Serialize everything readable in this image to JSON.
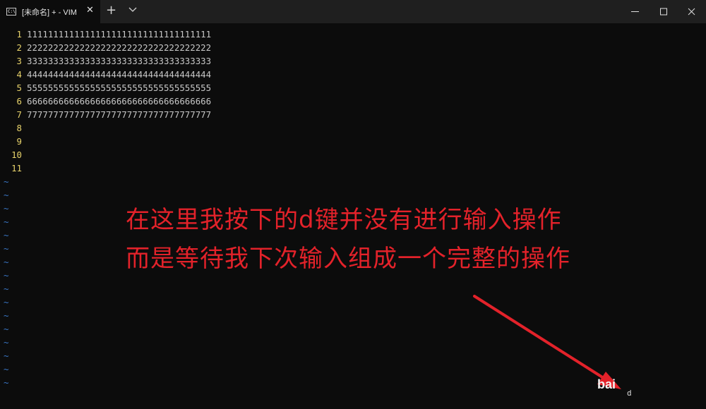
{
  "tab": {
    "icon": "console-icon",
    "title": "[未命名] + - VIM",
    "close": "✕"
  },
  "new_tab": "+",
  "window_controls": [
    "minimize-icon",
    "maximize-icon",
    "close-icon"
  ],
  "editor": {
    "lines": [
      {
        "num": "1",
        "text": "11111111111111111111111111111111111"
      },
      {
        "num": "2",
        "text": "22222222222222222222222222222222222"
      },
      {
        "num": "3",
        "text": "33333333333333333333333333333333333"
      },
      {
        "num": "4",
        "text": "44444444444444444444444444444444444"
      },
      {
        "num": "5",
        "text": "55555555555555555555555555555555555"
      },
      {
        "num": "6",
        "text": "66666666666666666666666666666666666"
      },
      {
        "num": "7",
        "text": "77777777777777777777777777777777777"
      },
      {
        "num": "8",
        "text": ""
      },
      {
        "num": "9",
        "text": ""
      },
      {
        "num": "10",
        "text": ""
      },
      {
        "num": "11",
        "text": ""
      }
    ],
    "tilde": "~",
    "pending_command": "d"
  },
  "annotation": {
    "line1": "在这里我按下的d键并没有进行输入操作",
    "line2": "而是等待我下次输入组成一个完整的操作"
  },
  "watermark": "bai",
  "colors": {
    "background": "#0c0c0c",
    "line_number": "#e8d36b",
    "text": "#c7c7c7",
    "tilde": "#3a77c6",
    "annotation": "#e3222a"
  }
}
